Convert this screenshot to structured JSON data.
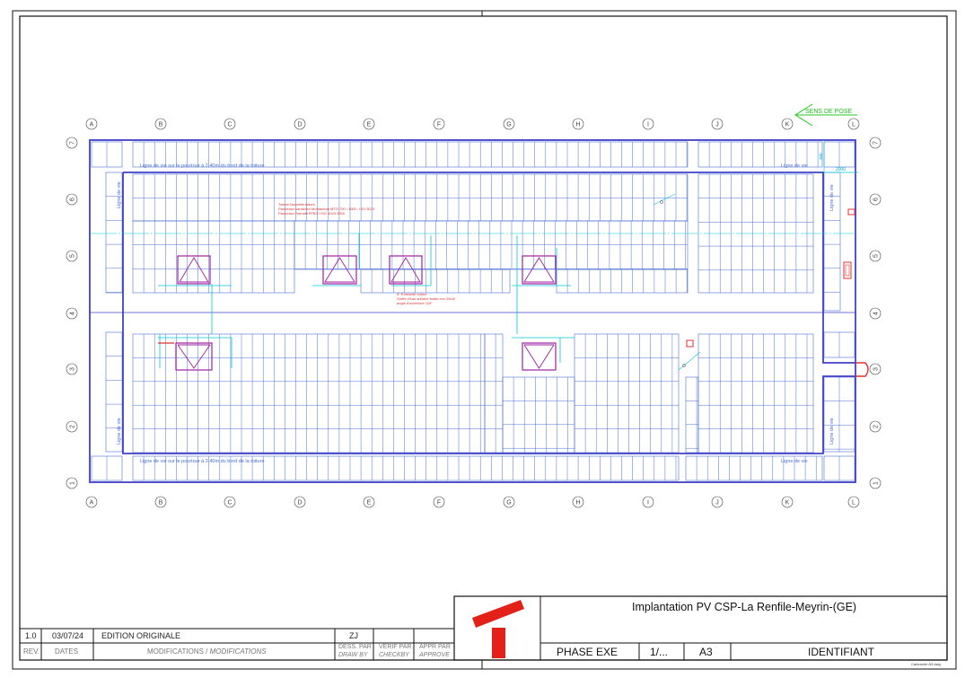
{
  "sheet": {
    "grid_columns": [
      "A",
      "B",
      "C",
      "D",
      "E",
      "F",
      "G",
      "H",
      "I",
      "J",
      "K",
      "L"
    ],
    "grid_rows": [
      "7",
      "6",
      "5",
      "4",
      "3",
      "2",
      "1"
    ],
    "direction_label": "SENS DE POSE",
    "lifeline_label": "Ligne de vie",
    "edge_note": "Ligne de vie sur le pourtour à 2,40m du bord de la toiture",
    "roof_note": [
      "Toiture Nouvelle toiture",
      "Panneaux sandwich Montauban MTO 700 / 1000 : ISO 3033",
      "Panneaux Sarnafil FPB3 / ISO 4023 3800"
    ],
    "slope_note": [
      "5° Existante toiture",
      "Sortie d'eau surface totale env 20m2",
      "angle d'ouverture 110°"
    ],
    "dim_label": "2000",
    "dim_label_v": "300"
  },
  "title_block": {
    "project_title": "Implantation PV CSP-La Renfile-Meyrin-(GE)",
    "phase": "PHASE EXE",
    "sheet_no": "1/...",
    "format": "A3",
    "identifiant": "IDENTIFIANT",
    "footer_note": "Cartouche A3.dwg",
    "revision": {
      "rev": "1.0",
      "date": "03/07/24",
      "modification": "EDITION ORIGINALE",
      "drawn_by": "ZJ"
    },
    "headers": {
      "rev": "REV.",
      "dates": "DATES",
      "modifications": "MODIFICATIONS / ",
      "modifications_it": "MODIFICATIONS",
      "dess_par": "DESS. PAR",
      "drawn_by": "DRAW BY",
      "verif_par": "VERIF PAR",
      "checkby": "CHECKBY",
      "appr_par": "APPR PAR",
      "approve": "APPROVE"
    },
    "logo_color": "#e32119"
  },
  "colors": {
    "panel": "#4a6fd0",
    "frame": "#4040c8",
    "skylight": "#a020a0",
    "cyan": "#00c8d8",
    "red": "#e03030",
    "green": "#22cc22"
  }
}
